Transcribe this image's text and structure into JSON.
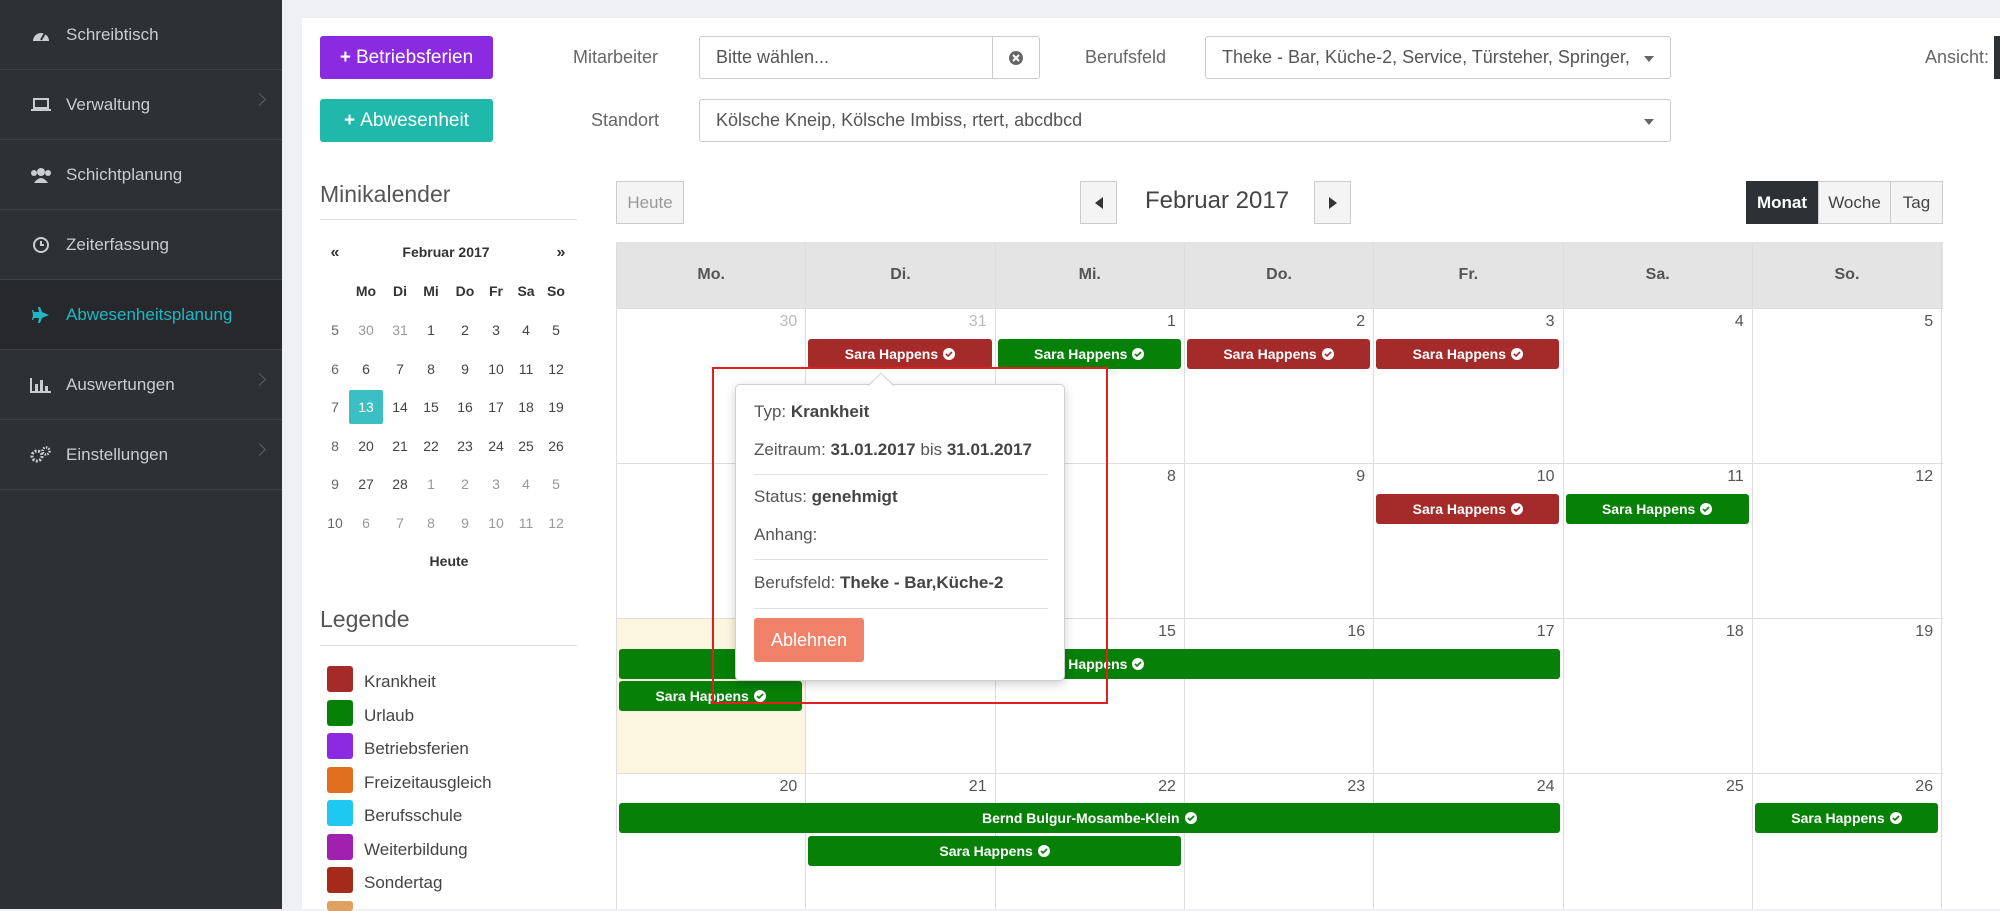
{
  "sidebar": {
    "items": [
      {
        "label": "Schreibtisch",
        "icon": "dashboard-icon"
      },
      {
        "label": "Verwaltung",
        "icon": "laptop-icon"
      },
      {
        "label": "Schichtplanung",
        "icon": "users-icon"
      },
      {
        "label": "Zeiterfassung",
        "icon": "clock-icon"
      },
      {
        "label": "Abwesenheitsplanung",
        "icon": "plane-icon"
      },
      {
        "label": "Auswertungen",
        "icon": "bar-chart-icon"
      },
      {
        "label": "Einstellungen",
        "icon": "gears-icon"
      }
    ],
    "active_index": 4
  },
  "toolbar": {
    "betriebsferien_label": "Betriebsferien",
    "abwesenheit_label": "Abwesenheit",
    "mitarbeiter_label": "Mitarbeiter",
    "mitarbeiter_placeholder": "Bitte wählen...",
    "berufsfeld_label": "Berufsfeld",
    "berufsfeld_value": "Theke - Bar, Küche-2, Service, Türsteher, Springer,",
    "standort_label": "Standort",
    "standort_value": "Kölsche Kneip, Kölsche Imbiss, rtert, abcdbcd",
    "ansicht_label": "Ansicht:"
  },
  "minikalender": {
    "title": "Minikalender",
    "prev": "«",
    "next": "»",
    "month_label": "Februar 2017",
    "weekdays": [
      "Mo",
      "Di",
      "Mi",
      "Do",
      "Fr",
      "Sa",
      "So"
    ],
    "weeks": [
      {
        "week": "5",
        "days": [
          "30",
          "31",
          "1",
          "2",
          "3",
          "4",
          "5"
        ]
      },
      {
        "week": "6",
        "days": [
          "6",
          "7",
          "8",
          "9",
          "10",
          "11",
          "12"
        ]
      },
      {
        "week": "7",
        "days": [
          "13",
          "14",
          "15",
          "16",
          "17",
          "18",
          "19"
        ]
      },
      {
        "week": "8",
        "days": [
          "20",
          "21",
          "22",
          "23",
          "24",
          "25",
          "26"
        ]
      },
      {
        "week": "9",
        "days": [
          "27",
          "28",
          "1",
          "2",
          "3",
          "4",
          "5"
        ]
      },
      {
        "week": "10",
        "days": [
          "6",
          "7",
          "8",
          "9",
          "10",
          "11",
          "12"
        ]
      }
    ],
    "today_label": "Heute"
  },
  "legende": {
    "title": "Legende",
    "items": [
      {
        "label": "Krankheit",
        "color": "#a52a2a"
      },
      {
        "label": "Urlaub",
        "color": "#078007"
      },
      {
        "label": "Betriebsferien",
        "color": "#8a2be2"
      },
      {
        "label": "Freizeitausgleich",
        "color": "#e07020"
      },
      {
        "label": "Berufsschule",
        "color": "#1ec8f0"
      },
      {
        "label": "Weiterbildung",
        "color": "#a020b0"
      },
      {
        "label": "Sondertag",
        "color": "#a52a1a"
      }
    ]
  },
  "calendar": {
    "today_button": "Heute",
    "month_title": "Februar 2017",
    "views": [
      "Monat",
      "Woche",
      "Tag"
    ],
    "active_view": "Monat",
    "day_headers": [
      "Mo.",
      "Di.",
      "Mi.",
      "Do.",
      "Fr.",
      "Sa.",
      "So."
    ],
    "weeks": [
      [
        "30",
        "31",
        "1",
        "2",
        "3",
        "4",
        "5"
      ],
      [
        "6",
        "7",
        "8",
        "9",
        "10",
        "11",
        "12"
      ],
      [
        "13",
        "14",
        "15",
        "16",
        "17",
        "18",
        "19"
      ],
      [
        "20",
        "21",
        "22",
        "23",
        "24",
        "25",
        "26"
      ]
    ],
    "events": [
      {
        "label": "Sara Happens",
        "type": "Krankheit"
      },
      {
        "label": "Sara Happens",
        "type": "Urlaub"
      },
      {
        "label": "Sara Happens",
        "type": "Krankheit"
      },
      {
        "label": "Sara Happens",
        "type": "Krankheit"
      },
      {
        "label": "Sara Happens",
        "type": "Krankheit"
      },
      {
        "label": "Sara Happens",
        "type": "Urlaub"
      },
      {
        "label": "Sara Happens",
        "type": "Urlaub"
      },
      {
        "label": "Sara Happens",
        "type": "Urlaub"
      },
      {
        "label": "Bernd Bulgur-Mosambe-Klein",
        "type": "Urlaub"
      },
      {
        "label": "Sara Happens",
        "type": "Urlaub"
      },
      {
        "label": "Sara Happens",
        "type": "Urlaub"
      }
    ]
  },
  "popover": {
    "typ_label": "Typ:",
    "typ_value": "Krankheit",
    "zeitraum_label": "Zeitraum:",
    "zeitraum_from": "31.01.2017",
    "zeitraum_bis": "bis",
    "zeitraum_to": "31.01.2017",
    "status_label": "Status:",
    "status_value": "genehmigt",
    "anhang_label": "Anhang:",
    "berufsfeld_label": "Berufsfeld:",
    "berufsfeld_value": "Theke - Bar,Küche-2",
    "ablehnen_label": "Ablehnen"
  }
}
